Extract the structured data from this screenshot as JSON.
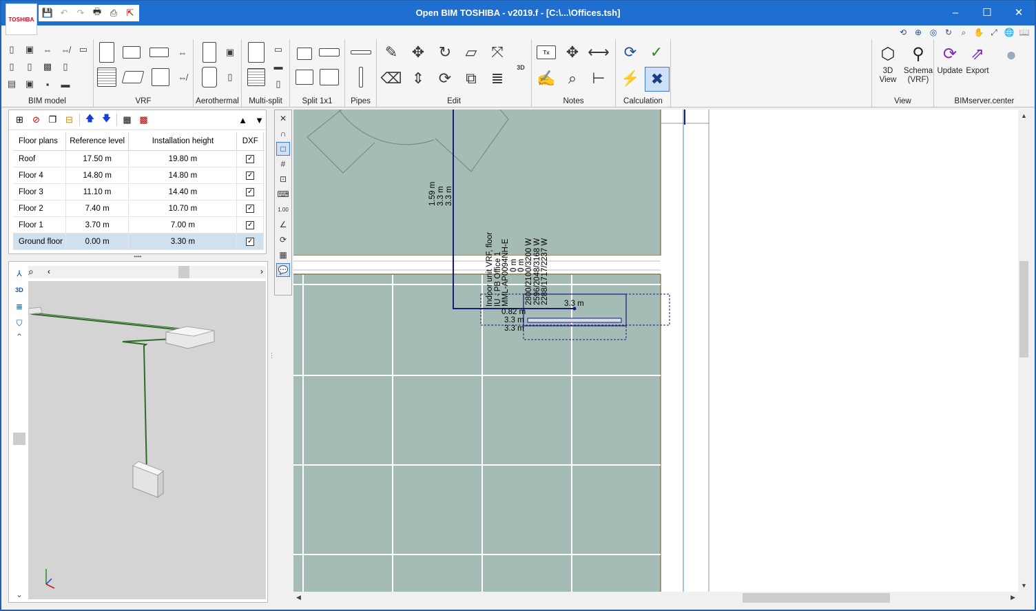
{
  "window": {
    "title": "Open BIM TOSHIBA - v2019.f - [C:\\...\\Offices.tsh]",
    "logo_text": "TOSHIBA",
    "controls": [
      "–",
      "☐",
      "✕"
    ]
  },
  "ribbon": {
    "groups": {
      "bim_model": "BIM model",
      "vrf": "VRF",
      "aerothermal": "Aerothermal",
      "multi_split": "Multi-split",
      "split": "Split 1x1",
      "pipes": "Pipes",
      "edit": "Edit",
      "notes": "Notes",
      "calculation": "Calculation",
      "view": "View",
      "bimserver": "BIMserver.center"
    },
    "view_buttons": {
      "view3d_line1": "3D",
      "view3d_line2": "View",
      "schema_line1": "Schema",
      "schema_line2": "(VRF)"
    },
    "bimserver_buttons": {
      "update": "Update",
      "export": "Export"
    }
  },
  "floors_table": {
    "headers": [
      "Floor plans",
      "Reference level",
      "Installation height",
      "DXF"
    ],
    "rows": [
      {
        "name": "Roof",
        "ref": "17.50 m",
        "height": "19.80 m",
        "dxf": true
      },
      {
        "name": "Floor 4",
        "ref": "14.80 m",
        "height": "14.80 m",
        "dxf": true
      },
      {
        "name": "Floor 3",
        "ref": "11.10 m",
        "height": "14.40 m",
        "dxf": true
      },
      {
        "name": "Floor 2",
        "ref": "7.40 m",
        "height": "10.70 m",
        "dxf": true
      },
      {
        "name": "Floor 1",
        "ref": "3.70 m",
        "height": "7.00 m",
        "dxf": true
      },
      {
        "name": "Ground floor",
        "ref": "0.00 m",
        "height": "3.30 m",
        "dxf": true,
        "selected": true
      }
    ]
  },
  "plan": {
    "pipe_labels": [
      "1.59 m",
      "3.3 m",
      "3.3 m"
    ],
    "unit_labels": [
      "Indoor unit VRF, floor",
      "IU - PB Office 1",
      "MML-AP0094NH-E",
      "0 m",
      "0 m"
    ],
    "power_labels": [
      "2800/2100/3200 W",
      "2596/2048/3168 W",
      "2288/1717/2237 W"
    ],
    "dims": {
      "top": "3.3 m",
      "a": "0.82 m",
      "b": "3.3 m",
      "c": "3.3 m"
    }
  }
}
